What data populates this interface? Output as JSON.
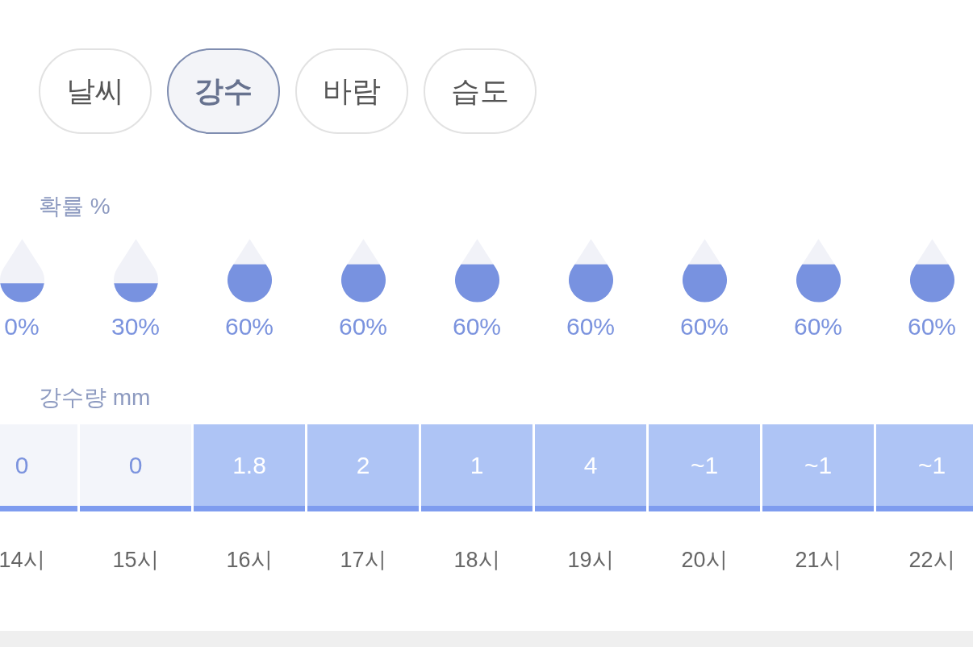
{
  "tabs": [
    {
      "label": "날씨",
      "selected": false
    },
    {
      "label": "강수",
      "selected": true
    },
    {
      "label": "바람",
      "selected": false
    },
    {
      "label": "습도",
      "selected": false
    }
  ],
  "probability": {
    "label": "확률 %",
    "hours": [
      {
        "level": 0.3,
        "reading": "0%"
      },
      {
        "level": 0.3,
        "reading": "30%"
      },
      {
        "level": 0.6,
        "reading": "60%"
      },
      {
        "level": 0.6,
        "reading": "60%"
      },
      {
        "level": 0.6,
        "reading": "60%"
      },
      {
        "level": 0.6,
        "reading": "60%"
      },
      {
        "level": 0.6,
        "reading": "60%"
      },
      {
        "level": 0.6,
        "reading": "60%"
      },
      {
        "level": 0.6,
        "reading": "60%"
      }
    ]
  },
  "amount": {
    "label": "강수량 mm",
    "hours": [
      {
        "value": "0",
        "rainy": false
      },
      {
        "value": "0",
        "rainy": false
      },
      {
        "value": "1.8",
        "rainy": true
      },
      {
        "value": "2",
        "rainy": true
      },
      {
        "value": "1",
        "rainy": true
      },
      {
        "value": "4",
        "rainy": true
      },
      {
        "value": "~1",
        "rainy": true
      },
      {
        "value": "~1",
        "rainy": true
      },
      {
        "value": "~1",
        "rainy": true
      }
    ]
  },
  "times": [
    "14시",
    "15시",
    "16시",
    "17시",
    "18시",
    "19시",
    "20시",
    "21시",
    "22시"
  ]
}
